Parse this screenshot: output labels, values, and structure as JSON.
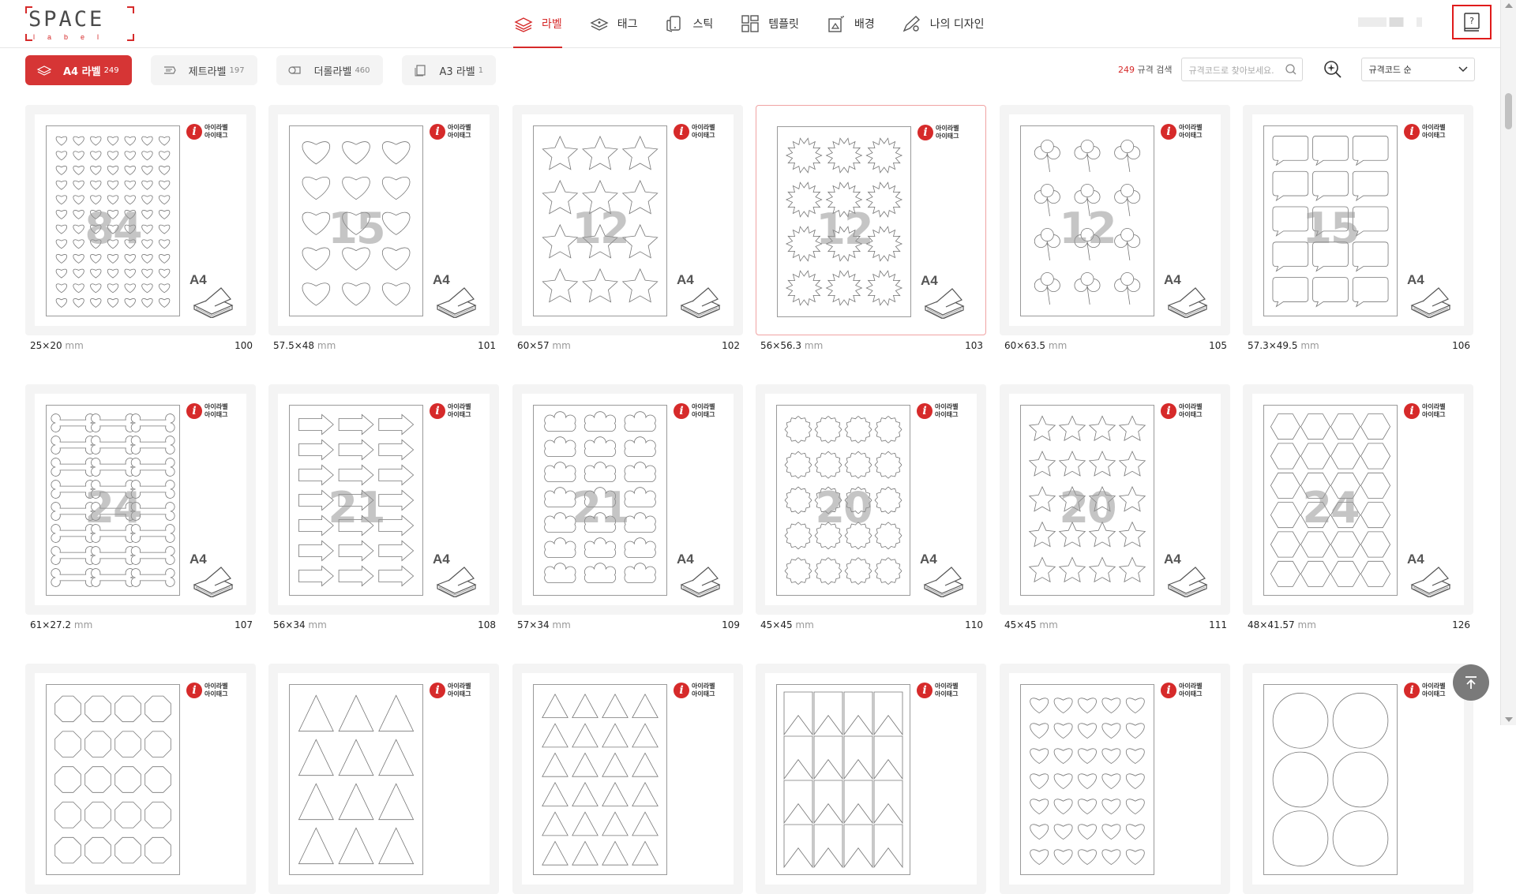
{
  "header": {
    "logo": {
      "word": "SPACE",
      "sub": "label"
    },
    "nav": [
      {
        "label": "라벨",
        "icon": "label-stack-icon",
        "active": true
      },
      {
        "label": "태그",
        "icon": "tag-stack-icon",
        "active": false
      },
      {
        "label": "스틱",
        "icon": "sticker-icon",
        "active": false
      },
      {
        "label": "템플릿",
        "icon": "template-grid-icon",
        "active": false
      },
      {
        "label": "배경",
        "icon": "background-icon",
        "active": false
      },
      {
        "label": "나의 디자인",
        "icon": "my-design-icon",
        "active": false
      }
    ],
    "help_icon": "help-book-icon"
  },
  "categories": [
    {
      "label": "A4 라벨",
      "count": "249",
      "active": true
    },
    {
      "label": "제트라벨",
      "count": "197",
      "active": false
    },
    {
      "label": "더롤라벨",
      "count": "460",
      "active": false
    },
    {
      "label": "A3 라벨",
      "count": "1",
      "active": false
    }
  ],
  "search": {
    "count": "249",
    "count_suffix": "규격 검색",
    "placeholder": "규격코드로 찾아보세요.",
    "value": "",
    "sort_value": "규격코드 순"
  },
  "card_common": {
    "brand_line1": "아이라벨",
    "brand_line2": "아이태그",
    "paper_badge": "A4",
    "unit": "mm"
  },
  "cards": [
    {
      "size": "25×20",
      "code": "100",
      "count": "84",
      "shape": "heart",
      "cols": 7,
      "rows": 12
    },
    {
      "size": "57.5×48",
      "code": "101",
      "count": "15",
      "shape": "heart",
      "cols": 3,
      "rows": 5
    },
    {
      "size": "60×57",
      "code": "102",
      "count": "12",
      "shape": "star",
      "cols": 3,
      "rows": 4
    },
    {
      "size": "56×56.3",
      "code": "103",
      "count": "12",
      "shape": "burst",
      "cols": 3,
      "rows": 4,
      "selected": true
    },
    {
      "size": "60×63.5",
      "code": "105",
      "count": "12",
      "shape": "clover",
      "cols": 3,
      "rows": 4
    },
    {
      "size": "57.3×49.5",
      "code": "106",
      "count": "15",
      "shape": "bubble",
      "cols": 3,
      "rows": 5
    },
    {
      "size": "61×27.2",
      "code": "107",
      "count": "24",
      "shape": "bone",
      "cols": 3,
      "rows": 8
    },
    {
      "size": "56×34",
      "code": "108",
      "count": "21",
      "shape": "arrow",
      "cols": 3,
      "rows": 7
    },
    {
      "size": "57×34",
      "code": "109",
      "count": "21",
      "shape": "cloud",
      "cols": 3,
      "rows": 7
    },
    {
      "size": "45×45",
      "code": "110",
      "count": "20",
      "shape": "scallop",
      "cols": 4,
      "rows": 5
    },
    {
      "size": "45×45",
      "code": "111",
      "count": "20",
      "shape": "star",
      "cols": 4,
      "rows": 5
    },
    {
      "size": "48×41.57",
      "code": "126",
      "count": "24",
      "shape": "hexagon",
      "cols": 4,
      "rows": 6
    },
    {
      "size": "",
      "code": "",
      "count": "",
      "shape": "octagon",
      "cols": 4,
      "rows": 5
    },
    {
      "size": "",
      "code": "",
      "count": "",
      "shape": "triangle",
      "cols": 3,
      "rows": 4
    },
    {
      "size": "",
      "code": "",
      "count": "",
      "shape": "triangle",
      "cols": 4,
      "rows": 6
    },
    {
      "size": "",
      "code": "",
      "count": "",
      "shape": "pennant",
      "cols": 4,
      "rows": 4
    },
    {
      "size": "",
      "code": "",
      "count": "",
      "shape": "heart",
      "cols": 5,
      "rows": 7
    },
    {
      "size": "",
      "code": "",
      "count": "",
      "shape": "circle",
      "cols": 2,
      "rows": 3
    }
  ],
  "scroll_top_icon": "arrow-up-icon"
}
